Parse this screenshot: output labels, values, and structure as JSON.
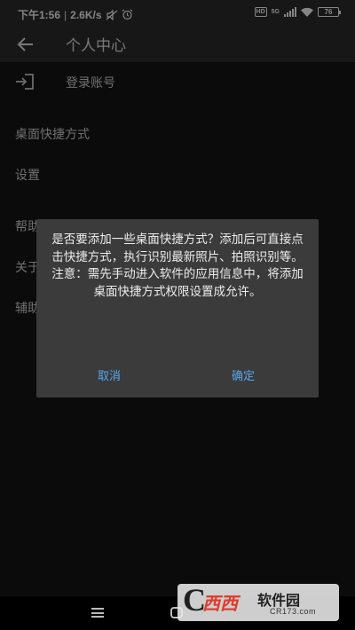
{
  "status_bar": {
    "time": "下午1:56",
    "speed": "2.6K/s",
    "hd": "HD",
    "network": "5G",
    "battery": "76"
  },
  "app_bar": {
    "title": "个人中心"
  },
  "menu": {
    "login": "登录账号",
    "desktop_shortcut": "桌面快捷方式",
    "settings": "设置",
    "help_partial": "帮助",
    "about_partial": "关于",
    "assist_partial": "辅助"
  },
  "dialog": {
    "message": "是否要添加一些桌面快捷方式？添加后可直接点击快捷方式，执行识别最新照片、拍照识别等。注意：需先手动进入软件的应用信息中，将添加桌面快捷方式权限设置成允许。",
    "cancel": "取消",
    "confirm": "确定"
  },
  "watermark": {
    "mark": "C",
    "chars": "西西",
    "name": "软件园",
    "url": "CR173.com"
  },
  "colors": {
    "accent": "#5aa6ec",
    "dialog_bg": "#3b3b3b",
    "app_bar_bg": "#2c2c2c"
  }
}
